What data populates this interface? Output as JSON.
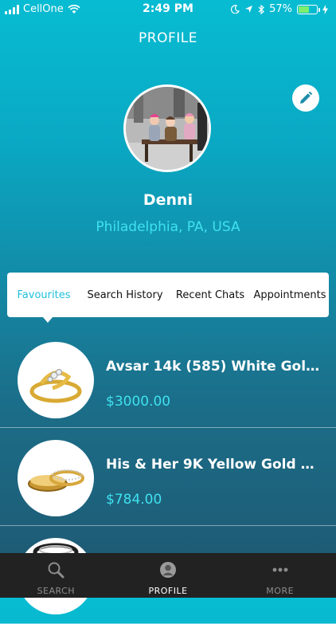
{
  "status_bar": {
    "carrier": "CellOne",
    "time": "2:49 PM",
    "battery": "57%"
  },
  "header": {
    "title": "PROFILE"
  },
  "profile": {
    "name": "Denni",
    "location": "Philadelphia, PA, USA"
  },
  "tabs": [
    {
      "label": "Favourites",
      "active": true
    },
    {
      "label": "Search History",
      "active": false
    },
    {
      "label": "Recent Chats",
      "active": false
    },
    {
      "label": "Appointments",
      "active": false
    }
  ],
  "favourites": [
    {
      "name": "Avsar 14k (585) White Gol...",
      "price": "$3000.00"
    },
    {
      "name": "His & Her 9K Yellow Gold D...",
      "price": "$784.00"
    }
  ],
  "bottom_nav": [
    {
      "label": "SEARCH",
      "icon": "search-icon"
    },
    {
      "label": "PROFILE",
      "icon": "profile-icon",
      "active": true
    },
    {
      "label": "MORE",
      "icon": "more-icon"
    }
  ],
  "colors": {
    "accent": "#3fe1ef",
    "active_tab": "#22c0dc",
    "tabbar_bg": "#222222"
  }
}
